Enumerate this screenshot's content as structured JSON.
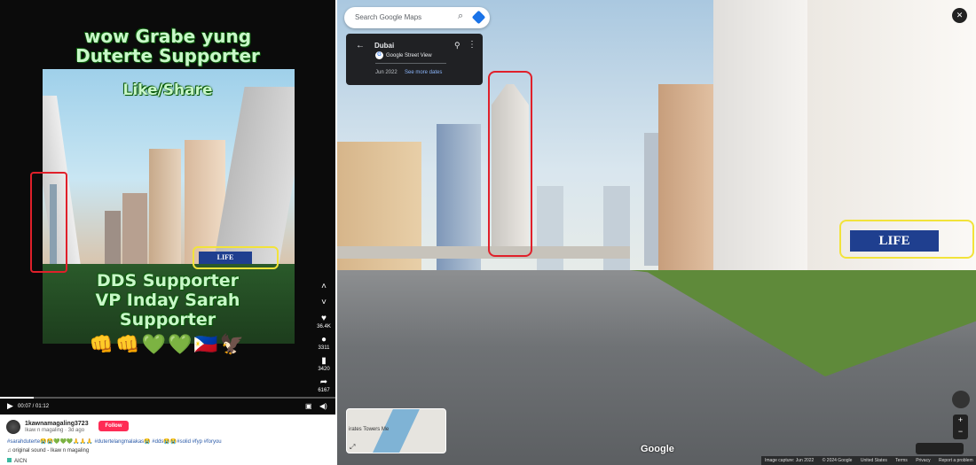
{
  "tiktok": {
    "caption_top": "wow Grabe yung\nDuterte Supporter",
    "caption_mid": "Like/Share",
    "caption_bottom": "DDS Supporter\nVP Inday Sarah\nSupporter",
    "emoji_row": "👊👊💚💚🇵🇭🦅",
    "sign_text": "LIFE",
    "side": {
      "likes": "36.4K",
      "comments": "3311",
      "saves": "3420",
      "shares": "6167"
    },
    "controls": {
      "time": "00:07 / 01:12",
      "progress": 0.1
    },
    "username": "1kawnamagaling3723",
    "subline": "Ikaw n magaling · 3d ago",
    "follow_label": "Follow",
    "hashtags": "#sarahduterte😭😭💚💚💚🙏🙏🙏  #dutertelangmalakas😭  #dds😭😭#solid  #fyp  #foryou",
    "sound": "♫ original sound - Ikaw n magaling",
    "effect": "AICN"
  },
  "streetview": {
    "search_placeholder": "Search Google Maps",
    "place": "Dubai",
    "source": "Google Street View",
    "date": "Jun 2022",
    "see_more": "See more dates",
    "sign_text": "LIFE",
    "minimap_label": "irates Towers Me",
    "google": "Google",
    "footer": {
      "capture": "Image capture: Jun 2022",
      "copyright": "© 2024 Google",
      "country": "United States",
      "terms": "Terms",
      "privacy": "Privacy",
      "report": "Report a problem"
    }
  },
  "colors": {
    "highlight_red": "#e0202a",
    "highlight_yellow": "#f2e33a",
    "follow": "#fe2c55",
    "maps_blue": "#1a73e8"
  }
}
